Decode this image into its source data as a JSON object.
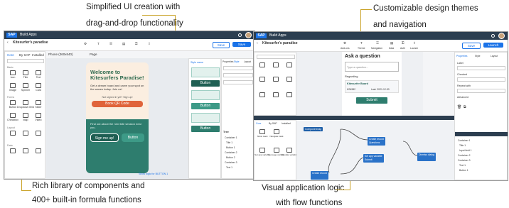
{
  "captions": {
    "left_top": [
      "Simplified UI creation with",
      "drag-and-drop functionality"
    ],
    "left_bottom": [
      "Rich library of components and",
      "400+ built-in formula functions"
    ],
    "right_top": [
      "Customizable design themes",
      "and navigation"
    ],
    "right_bottom": [
      "Visual application logic",
      "with flow functions"
    ]
  },
  "accent_color": "#c9a227",
  "left_screen": {
    "brand": "SAP",
    "app_title": "Build Apps",
    "project_name": "Kitesurfer's paradise",
    "page_selector": "Page",
    "view_selector": "Phone (360x640)",
    "save_button": "Save",
    "tabs": [
      "Core",
      "By SAP",
      "Installed"
    ],
    "sidebar_groups": [
      "Basic",
      "Forms",
      "Layout",
      "Data"
    ],
    "sidebar_items": [
      "Icon",
      "Title",
      "Text",
      "Image",
      "Spinner",
      "Card",
      "Button",
      "Dropdown field",
      "Slider",
      "Checkbox",
      "Map",
      "Video"
    ],
    "phone": {
      "heading": "Welcome to Kitesurfers Paradise!",
      "body": "Get a dream board and carve your spot on the waves today. Join us!",
      "signup_hint": "Not signed in yet? Sign up!",
      "primary_button": "Book QR Code",
      "promo": "Find out about the next kite session near you.",
      "sign_up_button": "Sign me up!",
      "secondary_button": "Button"
    },
    "right_panel": {
      "tabs": [
        "Properties",
        "Style",
        "Layout"
      ],
      "section_title": "Style name",
      "button_label": "Button",
      "secondary_label": "Button",
      "tree_title": "Tree",
      "tree_items": [
        "Container 1",
        "Title 1",
        "Button 1",
        "Container 2",
        "Button 2",
        "Container 3",
        "Text 1"
      ]
    },
    "footer": "Show logic for BUTTON 1"
  },
  "right_screen": {
    "brand": "SAP",
    "app_title": "Build Apps",
    "project_name": "Kitesurfer's paradise",
    "header_actions": [
      "Add-ons",
      "Theme",
      "Navigation",
      "Data",
      "Auth",
      "Launch"
    ],
    "save_button": "Save",
    "launch_button": "Launch",
    "question": {
      "title": "Ask a question",
      "field_label": "Type a question...",
      "card_title": "Regarding",
      "card_name": "Kitesurfer Board",
      "card_col1": "KS4982",
      "card_col2": "Last: 2021-12-30",
      "submit_button": "Submit"
    },
    "logic": {
      "tabs": [
        "Core",
        "By SAP",
        "Installed"
      ],
      "event_node": "Component tap",
      "nodes": [
        {
          "label": "Create record",
          "sub": "Questions"
        },
        {
          "label": "Set app variable",
          "sub": "Submit"
        },
        {
          "label": "Dismiss dialog",
          "sub": ""
        },
        {
          "label": "Create record",
          "sub": "Request"
        }
      ],
      "palette": [
        "Show toast",
        "Navigate back",
        "Set app variable",
        "Set page variable",
        "Set data variable"
      ]
    },
    "right_panel": {
      "tabs": [
        "Properties",
        "Style",
        "Layout"
      ],
      "rows": [
        "Label",
        "Checked",
        "Repeat with",
        "Advanced"
      ],
      "tree_items": [
        "Container 1",
        "Title 1",
        "Input field 1",
        "Container 2",
        "Container 3",
        "Text 1",
        "Button 1"
      ]
    }
  }
}
